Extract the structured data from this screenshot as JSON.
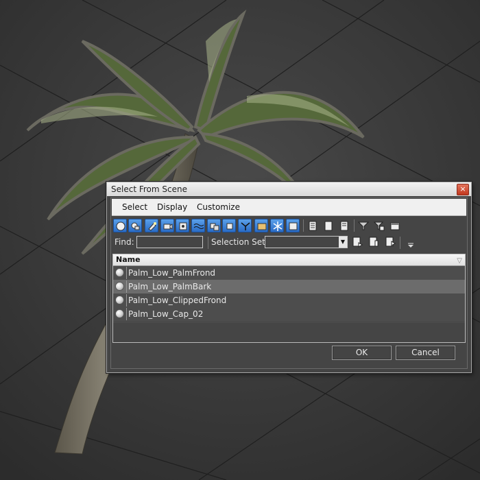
{
  "dialog": {
    "title": "Select From Scene",
    "close_glyph": "×",
    "menu": [
      "Select",
      "Display",
      "Customize"
    ],
    "find_label": "Find:",
    "find_value": "",
    "selection_set_label": "Selection Set:",
    "selection_set_value": "",
    "list": {
      "header": "Name",
      "rows": [
        {
          "name": "Palm_Low_PalmFrond",
          "selected": false
        },
        {
          "name": "Palm_Low_PalmBark",
          "selected": true
        },
        {
          "name": "Palm_Low_ClippedFrond",
          "selected": false
        },
        {
          "name": "Palm_Low_Cap_02",
          "selected": false
        }
      ]
    },
    "ok_label": "OK",
    "cancel_label": "Cancel"
  },
  "toolbar_icons": [
    "display-geometry-icon",
    "display-shapes-icon",
    "display-lights-icon",
    "display-cameras-icon",
    "display-helpers-icon",
    "display-spacewarps-icon",
    "display-groups-icon",
    "display-xrefs-icon",
    "display-bones-icon",
    "display-containers-icon",
    "display-frozen-icon",
    "display-hidden-icon",
    "select-all-icon",
    "select-none-icon",
    "select-invert-icon",
    "filter-icon",
    "filter-list-icon",
    "columns-icon"
  ],
  "colors": {
    "toolbar_active": "#3d86dc",
    "selected_row": "#6c6c6c",
    "dialog_bg": "#444444"
  }
}
